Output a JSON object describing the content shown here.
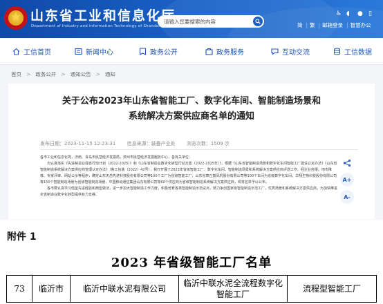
{
  "header": {
    "site_title": "山东省工业和信息化厅",
    "site_subtitle": "Department of Industry and Information Technology of Shandong Province",
    "search_placeholder": "请输入您要搜索的内容",
    "top_links": [
      "简",
      "繁",
      "邮箱登录",
      "智慧办公"
    ],
    "icons": [
      "accessibility-icon",
      "speaker-icon",
      "person-icon",
      "mobile-icon"
    ]
  },
  "nav": [
    {
      "label": "工信首页",
      "icon": "home-icon"
    },
    {
      "label": "新闻中心",
      "icon": "news-icon"
    },
    {
      "label": "政务公开",
      "icon": "publicity-icon"
    },
    {
      "label": "政务服务",
      "icon": "service-icon"
    },
    {
      "label": "互动交流",
      "icon": "chat-icon"
    },
    {
      "label": "工信数据",
      "icon": "data-icon"
    }
  ],
  "breadcrumb": [
    "首页",
    "政务公开",
    "通知公告",
    "通知"
  ],
  "article": {
    "title_line1": "关于公布2023年山东省智能工厂、数字化车间、智能制造场景和",
    "title_line2": "系统解决方案供应商名单的通知",
    "publish_time": "发布日期：2023-11-15 12:23:31",
    "source": "信息来源：装备产业处",
    "views": "浏览次数：1509 次",
    "para1": "各市工业和信息化局，济南、青岛市民营经济发展局，滨州市民营经济发展服务中心，各有关单位：",
    "para2": "为认真落实《先进制造业强省行动计划（2022-2025）》和《山东省制造业数字化转型行动方案（2022-2025年）》，根据《山东省智能制造场景和数字化车间智能工厂建设认定办法》《山东省智能制造系统解决方案供应商管理认定办法》（鲁工信装〔2022〕42号），我厅开展了2023年省级智能工厂、数字化车间、智能制造场景和系统解决方案供应商评选工作。经企业自报、地市推荐、专家评审、网站公示等程序，确定山东天岳先进科技股份有限公司等100个工厂为省级智能工厂，山东省章丘鼓风机股份有限公司等100个车间为省级数字化车间，华翔生物科技股份有限公司等150个智能制造场景为省级智能制造场景，中国移动通信集团山东有限公司等60个供应商为省级智能制造系统解决方案供应商，现将名单予以公布。",
    "para3": "各市要认真学习借鉴先进经验和典型做法，进一步加大智能制造工作力度，积极培育各类智能制造示范试点，努力争创国家级智能制造示范工厂，优秀场景和系统解决方案供应商，为加快推进全省制造业数字化转型提供有力支撑。",
    "tools": [
      "share-icon",
      "A+",
      "A-"
    ]
  },
  "attachment": {
    "label": "附件 1",
    "title": "2023 年省级智能工厂名单",
    "row": [
      "73",
      "临沂市",
      "临沂中联水泥有限公司",
      "临沂中联水泥全流程数字化智能工厂",
      "流程型智能工厂"
    ]
  },
  "colors": {
    "header_blue": "#1a63c8",
    "nav_text": "#1f56b4",
    "content_bg": "#f3f5f9"
  }
}
